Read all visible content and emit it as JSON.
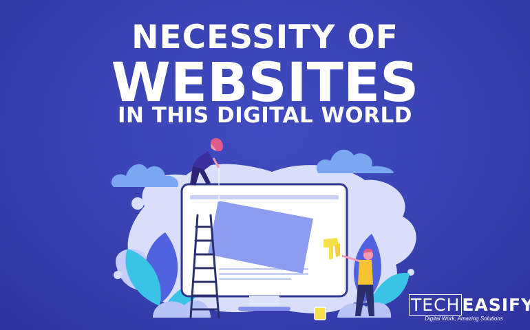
{
  "headline": {
    "line1": "NECESSITY OF",
    "line2": "WEBSITES",
    "line3": "IN THIS DIGITAL WORLD"
  },
  "brand": {
    "name_part1": "TECH",
    "name_part2": "EASIFY",
    "tagline": "Digital Work, Amazing Solutions"
  },
  "colors": {
    "background": "#3a44b4",
    "blob": "#d9defb",
    "cloud": "#7aa6f2",
    "leaf_cyan": "#39c3e6",
    "leaf_blue": "#4f63e0",
    "screen_panel": "#8c9cf0",
    "paint_yellow": "#f6e04a",
    "text": "#ffffff"
  },
  "illustration": {
    "description_icons": [
      "monitor-icon",
      "ladder-icon",
      "paint-brush-icon",
      "paint-bucket-icon",
      "cloud-icon",
      "leaf-icon"
    ]
  }
}
